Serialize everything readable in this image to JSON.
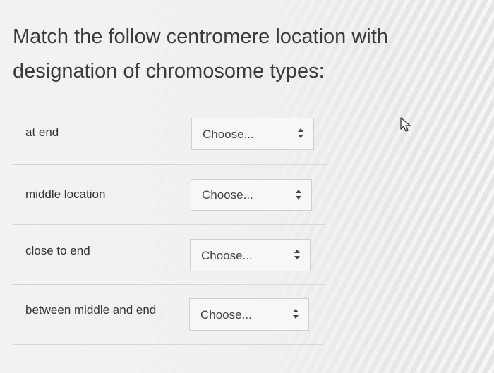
{
  "question": {
    "line1": "Match the follow centromere location with",
    "line2": "designation of chromosome types:"
  },
  "rows": [
    {
      "label": "at end",
      "select_value": "Choose..."
    },
    {
      "label": "middle location",
      "select_value": "Choose..."
    },
    {
      "label": "close to end",
      "select_value": "Choose..."
    },
    {
      "label": "between middle and end",
      "select_value": "Choose..."
    }
  ],
  "icons": {
    "select_arrows": "up-down-arrows-icon",
    "cursor": "mouse-pointer-icon"
  }
}
